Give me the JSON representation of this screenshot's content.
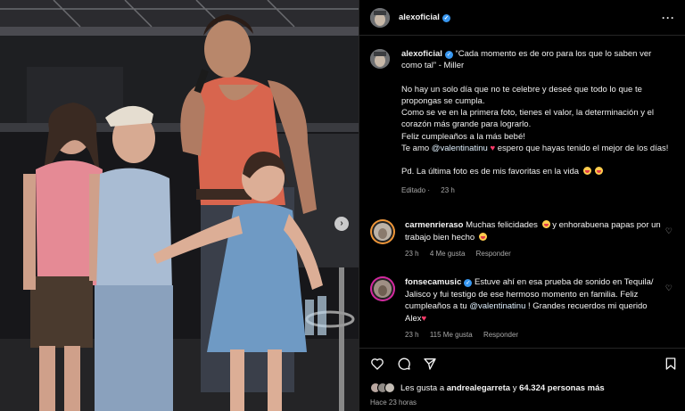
{
  "post": {
    "username": "alexoficial",
    "header_username": "alexoficial",
    "caption_lines": [
      "“Cada momento es de oro para los que lo saben ver como tal” - Miller",
      "No hay un solo día que no te celebre y deseé que todo lo que te propongas se cumpla.",
      "Como se ve en la primera foto, tienes el valor, la determinación y el corazón más grande para lograrlo.",
      "Feliz cumpleaños a la más bebé!",
      "Te amo",
      "@valentinatinu",
      "espero que hayas tenido el mejor de los días!",
      "Pd. La última foto es de mis favoritas en la vida"
    ],
    "edited_label": "Editado",
    "edited_time": "23 h"
  },
  "comments": [
    {
      "username": "carmenrieraso",
      "text_a": "Muchas felicidades",
      "text_b": "y enhorabuena papas por un trabajo bien hecho",
      "time": "23 h",
      "likes": "4 Me gusta",
      "reply": "Responder"
    },
    {
      "username": "fonsecamusic",
      "text_a": "Estuve ahí en esa prueba de sonido en Tequila/ Jalisco y fui testigo de ese hermoso momento en familia. Feliz cumpleaños a tu",
      "mention": "@valentinatinu",
      "text_b": "! Grandes recuerdos mi querido Alex",
      "time": "23 h",
      "likes": "115 Me gusta",
      "reply": "Responder"
    }
  ],
  "likes_bar": {
    "prefix": "Les gusta a",
    "user": "andrealegarreta",
    "middle": "y",
    "count": "64.324 personas más",
    "time_ago": "Hace 23 horas"
  },
  "icons": {
    "verified": "verified-badge-icon",
    "more": "more-options-icon",
    "like": "heart-icon",
    "comment": "comment-icon",
    "share": "paper-plane-icon",
    "save": "bookmark-icon",
    "next": "chevron-right-icon"
  },
  "colors": {
    "background": "#000000",
    "verified": "#3897f0",
    "muted": "#a8a8a8",
    "mention": "#e0f1ff"
  }
}
